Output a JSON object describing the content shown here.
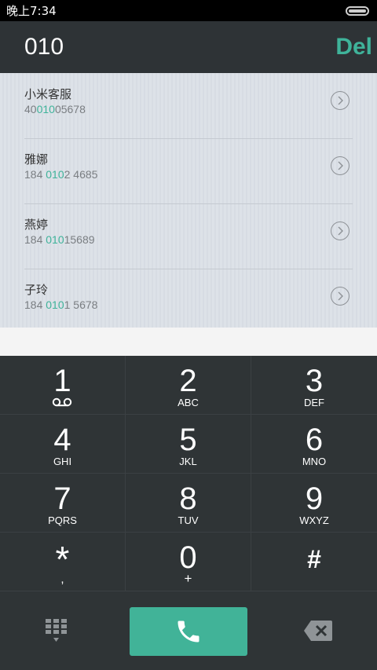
{
  "status_bar": {
    "time": "晚上7:34"
  },
  "header": {
    "number": "010",
    "del_label": "Del"
  },
  "contacts": [
    {
      "name": "小米客服",
      "phone_pre": "40",
      "phone_match": "010",
      "phone_post": "05678"
    },
    {
      "name": "雅娜",
      "phone_pre": "184 ",
      "phone_match": "010",
      "phone_post": "2 4685"
    },
    {
      "name": "燕婷",
      "phone_pre": "184 ",
      "phone_match": "010",
      "phone_post": "15689"
    },
    {
      "name": "子玲",
      "phone_pre": "184 ",
      "phone_match": "010",
      "phone_post": "1 5678"
    }
  ],
  "keypad": {
    "keys": [
      {
        "digit": "1",
        "letters": ""
      },
      {
        "digit": "2",
        "letters": "ABC"
      },
      {
        "digit": "3",
        "letters": "DEF"
      },
      {
        "digit": "4",
        "letters": "GHI"
      },
      {
        "digit": "5",
        "letters": "JKL"
      },
      {
        "digit": "6",
        "letters": "MNO"
      },
      {
        "digit": "7",
        "letters": "PQRS"
      },
      {
        "digit": "8",
        "letters": "TUV"
      },
      {
        "digit": "9",
        "letters": "WXYZ"
      },
      {
        "digit": "*",
        "letters": ","
      },
      {
        "digit": "0",
        "letters": "+"
      },
      {
        "digit": "#",
        "letters": ""
      }
    ]
  },
  "colors": {
    "accent": "#3fb39a",
    "call_button": "#41b398",
    "keypad_bg": "#2f3436"
  },
  "icons": {
    "voicemail": "voicemail-icon",
    "keypad_toggle": "dialpad-icon",
    "call": "phone-icon",
    "backspace": "backspace-icon",
    "chevron": "chevron-right-icon"
  }
}
